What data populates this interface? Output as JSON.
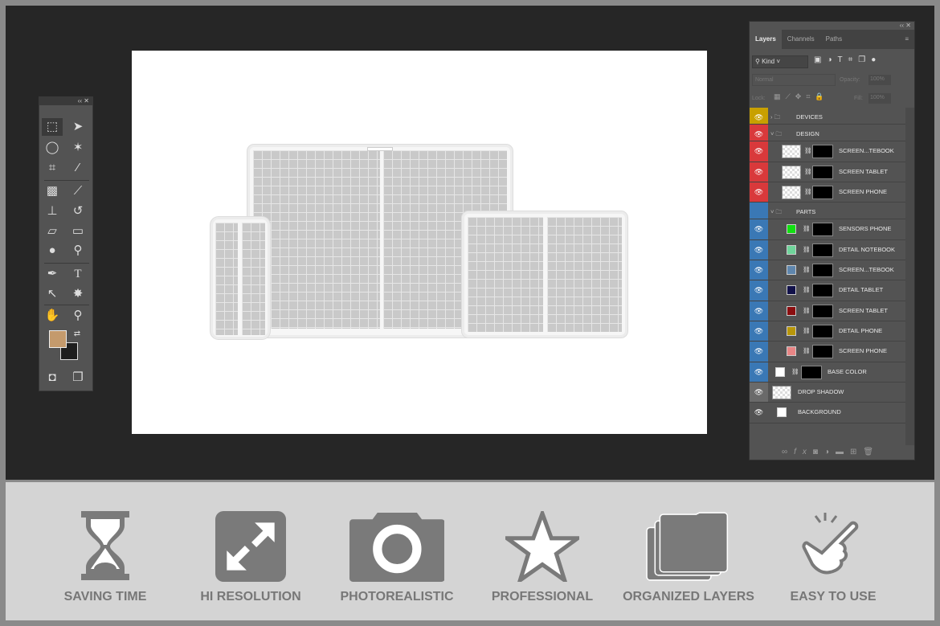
{
  "toolbox": {
    "collapse": "‹‹ ✕",
    "foreground_color": "#c49a6c",
    "background_color": "#1e1e1e"
  },
  "layers_panel": {
    "tabs": [
      "Layers",
      "Channels",
      "Paths"
    ],
    "filter": "Kind",
    "blend_mode": "Normal",
    "opacity_label": "Opacity:",
    "opacity": "100%",
    "lock_label": "Lock:",
    "fill_label": "Fill:",
    "fill": "100%",
    "layers": [
      {
        "name": "DEVICES",
        "type": "group",
        "collapsed": true,
        "indent": 0,
        "eye_color": "#c8a000"
      },
      {
        "name": "DESIGN",
        "type": "group",
        "collapsed": false,
        "indent": 0,
        "eye_color": "#d9393b"
      },
      {
        "name": "SCREEN...TEBOOK",
        "type": "smart",
        "indent": 1,
        "eye_color": "#d9393b"
      },
      {
        "name": "SCREEN TABLET",
        "type": "smart",
        "indent": 1,
        "eye_color": "#d9393b"
      },
      {
        "name": "SCREEN PHONE",
        "type": "smart",
        "indent": 1,
        "eye_color": "#d9393b"
      },
      {
        "name": "PARTS",
        "type": "group",
        "collapsed": false,
        "indent": 0,
        "eye_color": "#3a78b5",
        "hidden": true
      },
      {
        "name": "SENSORS PHONE",
        "type": "fill",
        "swatch": "#11e011",
        "indent": 1,
        "eye_color": "#3a78b5"
      },
      {
        "name": "DETAIL NOTEBOOK",
        "type": "fill",
        "swatch": "#6fd49a",
        "indent": 1,
        "eye_color": "#3a78b5"
      },
      {
        "name": "SCREEN...TEBOOK",
        "type": "fill",
        "swatch": "#5f86ad",
        "indent": 1,
        "eye_color": "#3a78b5"
      },
      {
        "name": "DETAIL TABLET",
        "type": "fill",
        "swatch": "#12124a",
        "indent": 1,
        "eye_color": "#3a78b5"
      },
      {
        "name": "SCREEN TABLET",
        "type": "fill",
        "swatch": "#8b0e10",
        "indent": 1,
        "eye_color": "#3a78b5"
      },
      {
        "name": "DETAIL PHONE",
        "type": "fill",
        "swatch": "#b8960a",
        "indent": 1,
        "eye_color": "#3a78b5"
      },
      {
        "name": "SCREEN PHONE",
        "type": "fill",
        "swatch": "#e88585",
        "indent": 1,
        "eye_color": "#3a78b5"
      },
      {
        "name": "BASE COLOR",
        "type": "fill",
        "swatch": "#ffffff",
        "indent": 0,
        "eye_color": "#3a78b5"
      },
      {
        "name": "DROP SHADOW",
        "type": "pixel",
        "indent": 0,
        "eye_color": "#6a6a6a"
      },
      {
        "name": "BACKGROUND",
        "type": "background",
        "indent": 0,
        "eye_color": "#535353"
      }
    ],
    "footer_icons": [
      "link-icon",
      "fx-icon",
      "mask-icon",
      "adjustment-icon",
      "folder-icon",
      "new-layer-icon",
      "trash-icon"
    ]
  },
  "features": [
    {
      "label": "SAVING TIME",
      "icon": "hourglass-icon"
    },
    {
      "label": "HI RESOLUTION",
      "icon": "expand-icon"
    },
    {
      "label": "PHOTOREALISTIC",
      "icon": "camera-icon"
    },
    {
      "label": "PROFESSIONAL",
      "icon": "star-icon"
    },
    {
      "label": "ORGANIZED LAYERS",
      "icon": "folders-icon"
    },
    {
      "label": "EASY TO USE",
      "icon": "snap-hand-icon"
    }
  ]
}
